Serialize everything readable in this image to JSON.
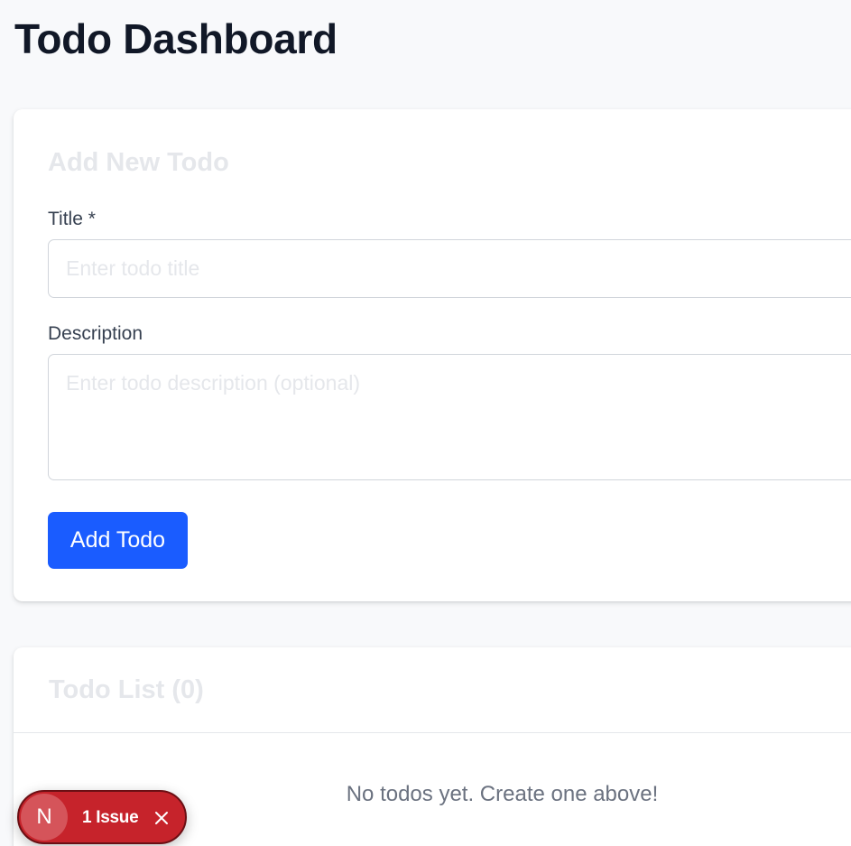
{
  "header": {
    "title": "Todo Dashboard"
  },
  "add_form": {
    "heading": "Add New Todo",
    "title_label": "Title *",
    "title_value": "",
    "title_placeholder": "Enter todo title",
    "description_label": "Description",
    "description_value": "",
    "description_placeholder": "Enter todo description (optional)",
    "submit_label": "Add Todo"
  },
  "todo_list": {
    "heading": "Todo List (0)",
    "empty_message": "No todos yet. Create one above!"
  },
  "issue_badge": {
    "logo_letter": "N",
    "label": "1 Issue",
    "close_icon": "close-icon"
  },
  "colors": {
    "page_background": "#f8f9fb",
    "primary_button": "#1a5cff",
    "issue_badge": "#c6232b",
    "muted_text": "#6b7280"
  }
}
